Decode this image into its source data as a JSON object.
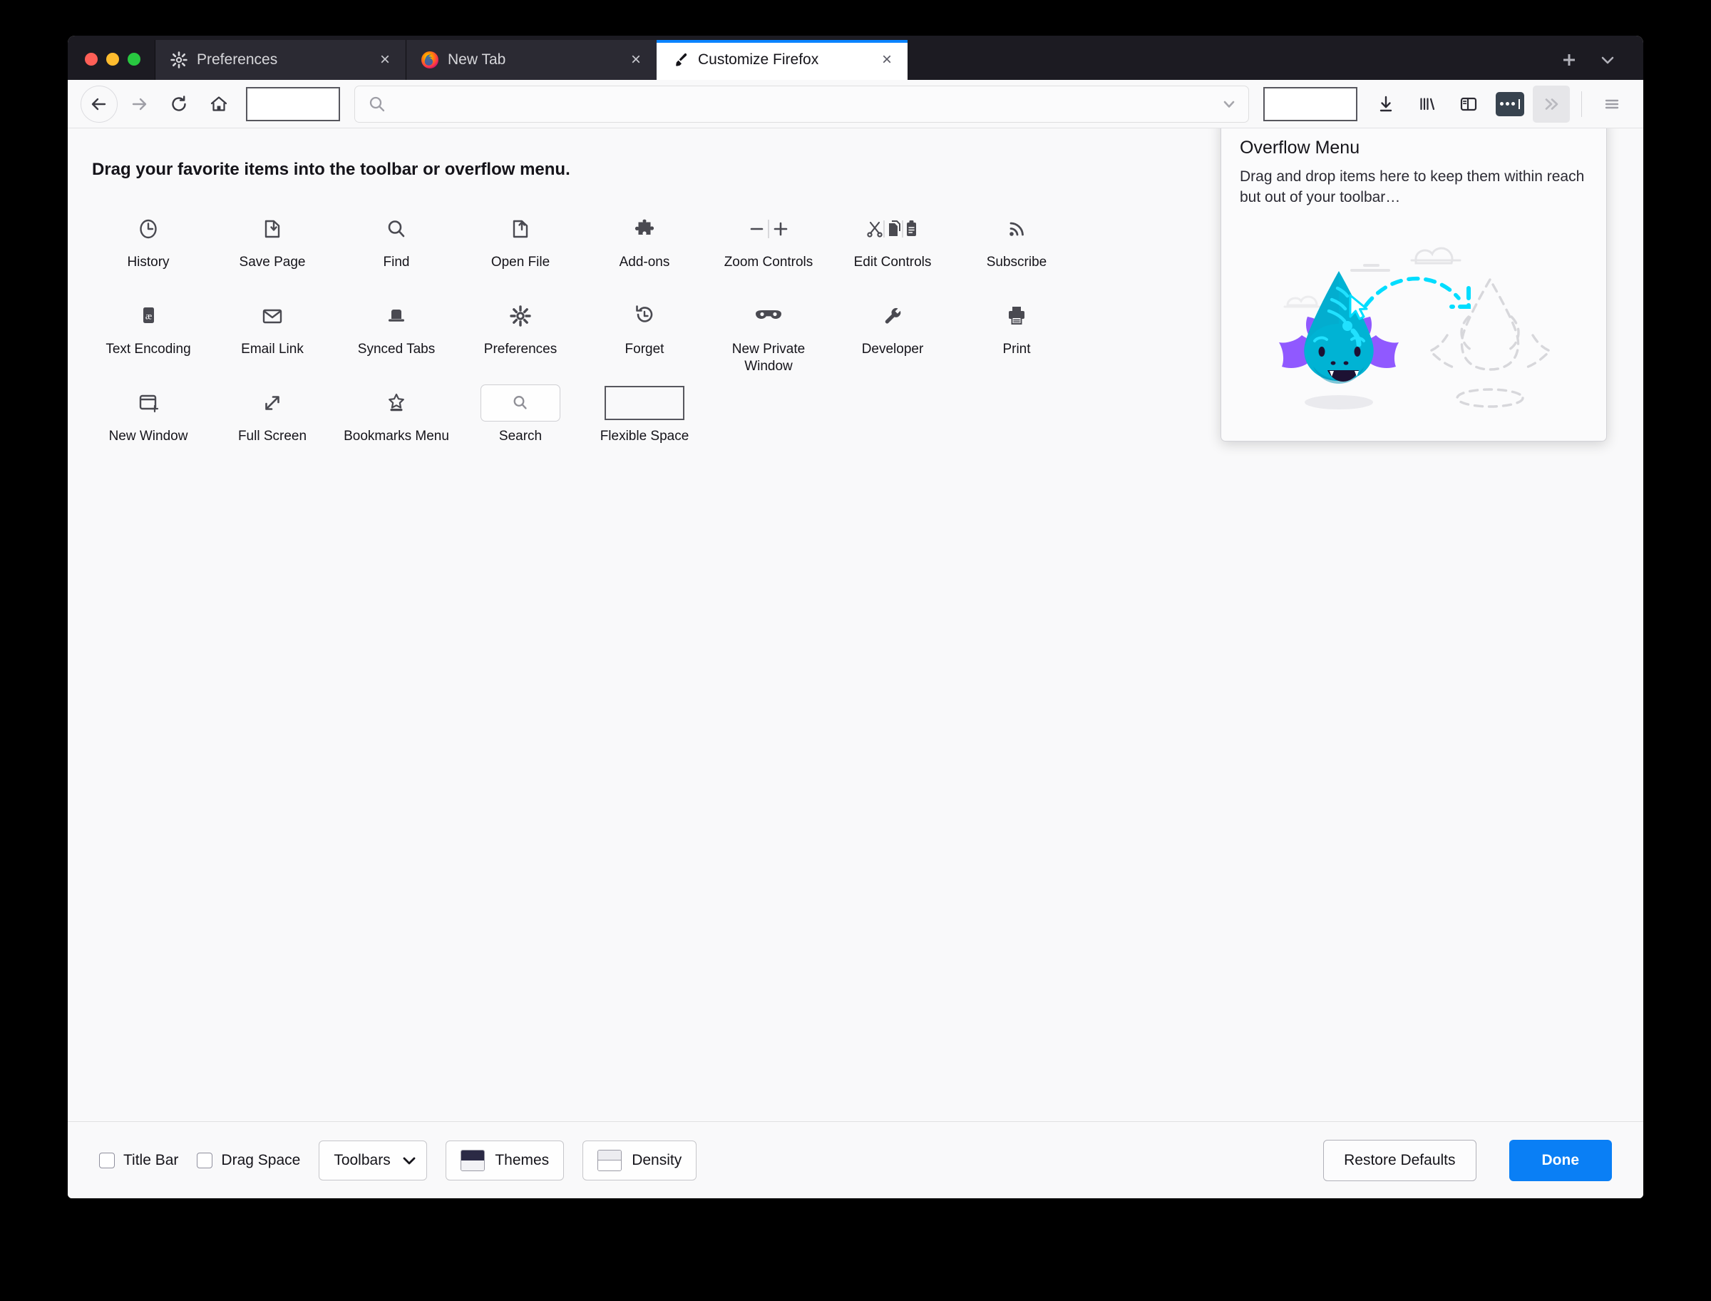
{
  "window": {
    "traffic_lights": [
      "close",
      "minimize",
      "maximize"
    ],
    "colors": {
      "accent": "#0a7ff5",
      "tabstrip_bg": "#1c1b22",
      "active_tab_indicator": "#0a84ff",
      "chrome_bg": "#f9f9fa"
    }
  },
  "tabs": [
    {
      "label": "Preferences",
      "icon": "gear-icon",
      "active": false,
      "close": "×"
    },
    {
      "label": "New Tab",
      "icon": "firefox-logo-icon",
      "active": false,
      "close": "×"
    },
    {
      "label": "Customize Firefox",
      "icon": "paintbrush-icon",
      "active": true,
      "close": "×"
    }
  ],
  "tabstrip_buttons": [
    {
      "name": "new-tab-button",
      "glyph": "+"
    },
    {
      "name": "list-all-tabs-button",
      "glyph": "˅"
    }
  ],
  "navbar": {
    "back": "back-arrow-icon",
    "forward": "forward-arrow-icon",
    "reload": "reload-icon",
    "home": "home-icon",
    "flexible_space_placeholder": "flexible-space-slot",
    "urlbar": {
      "value": "",
      "placeholder": "",
      "left_icon": "search-icon",
      "right_icon": "chevron-down-icon"
    },
    "right_buttons": [
      {
        "name": "flexible-space-slot-right",
        "icon": "flexible-space-slot"
      },
      {
        "name": "downloads-button",
        "icon": "download-icon"
      },
      {
        "name": "library-button",
        "icon": "library-icon"
      },
      {
        "name": "sidebar-button",
        "icon": "sidebar-icon"
      },
      {
        "name": "page-actions-button",
        "icon": "page-actions-icon"
      },
      {
        "name": "overflow-button",
        "icon": "double-chevron-right-icon"
      },
      {
        "name": "app-menu-button",
        "icon": "hamburger-icon"
      }
    ]
  },
  "customize": {
    "title": "Drag your favorite items into the toolbar or overflow menu.",
    "palette": [
      {
        "label": "History",
        "icon": "clock-icon"
      },
      {
        "label": "Save Page",
        "icon": "save-page-icon"
      },
      {
        "label": "Find",
        "icon": "search-icon"
      },
      {
        "label": "Open File",
        "icon": "open-file-icon"
      },
      {
        "label": "Add-ons",
        "icon": "puzzle-piece-icon"
      },
      {
        "label": "Zoom Controls",
        "icon": "zoom-controls-icon"
      },
      {
        "label": "Edit Controls",
        "icon": "edit-controls-icon"
      },
      {
        "label": "Subscribe",
        "icon": "rss-icon"
      },
      {
        "label": "Text Encoding",
        "icon": "text-encoding-icon"
      },
      {
        "label": "Email Link",
        "icon": "envelope-icon"
      },
      {
        "label": "Synced Tabs",
        "icon": "synced-tabs-icon"
      },
      {
        "label": "Preferences",
        "icon": "gear-icon"
      },
      {
        "label": "Forget",
        "icon": "forget-icon"
      },
      {
        "label": "New Private Window",
        "icon": "mask-icon"
      },
      {
        "label": "Developer",
        "icon": "wrench-icon"
      },
      {
        "label": "Print",
        "icon": "printer-icon"
      },
      {
        "label": "New Window",
        "icon": "new-window-icon"
      },
      {
        "label": "Full Screen",
        "icon": "fullscreen-arrows-icon"
      },
      {
        "label": "Bookmarks Menu",
        "icon": "bookmark-star-icon"
      },
      {
        "label": "Search",
        "icon": "search-widget"
      },
      {
        "label": "Flexible Space",
        "icon": "flexible-space-widget"
      }
    ]
  },
  "overflow_panel": {
    "title": "Overflow Menu",
    "description": "Drag and drop items here to keep them within reach but out of your toolbar…",
    "illustration": "drag-monster-illustration",
    "illustration_colors": {
      "body": "#00b3d4",
      "body_dark": "#0097b8",
      "horns": "#9059ff",
      "highlight": "#21e1ff",
      "outline_dashed": "#d7d7db"
    }
  },
  "footer": {
    "checkboxes": [
      {
        "label": "Title Bar",
        "checked": false
      },
      {
        "label": "Drag Space",
        "checked": false
      }
    ],
    "toolbars_button": {
      "label": "Toolbars",
      "icon": "chevron-down-icon"
    },
    "themes_button": {
      "label": "Themes",
      "icon": "theme-swatch-icon"
    },
    "density_button": {
      "label": "Density",
      "icon": "density-icon"
    },
    "restore_defaults_button": "Restore Defaults",
    "done_button": "Done"
  }
}
